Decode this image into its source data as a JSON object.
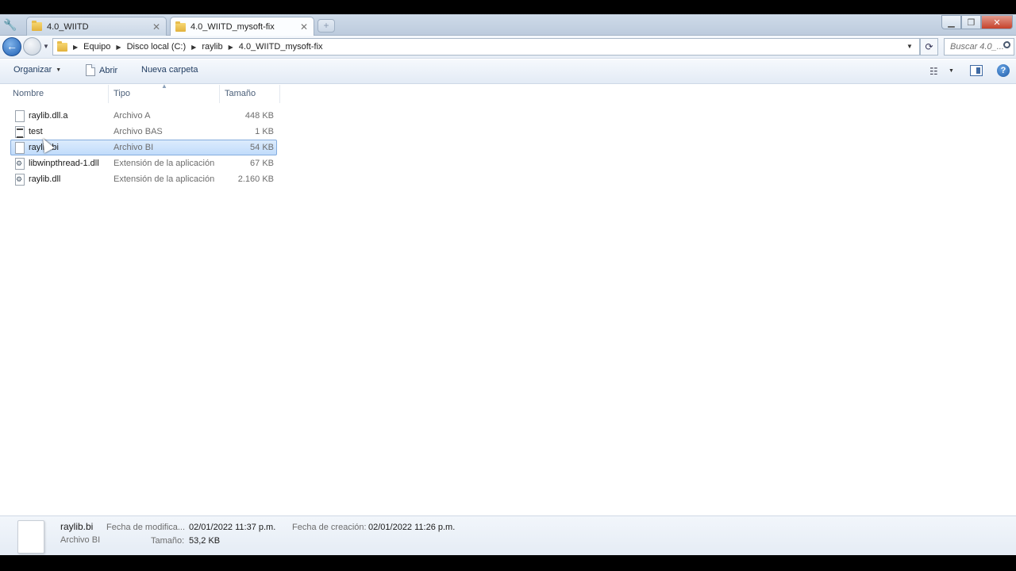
{
  "tabs": [
    {
      "label": "4.0_WIITD",
      "active": false
    },
    {
      "label": "4.0_WIITD_mysoft-fix",
      "active": true
    }
  ],
  "address": {
    "crumbs": [
      "Equipo",
      "Disco local (C:)",
      "raylib",
      "4.0_WIITD_mysoft-fix"
    ],
    "search_placeholder": "Buscar 4.0_..."
  },
  "toolbar": {
    "organize_label": "Organizar",
    "open_label": "Abrir",
    "new_folder_label": "Nueva carpeta"
  },
  "columns": {
    "name": "Nombre",
    "type": "Tipo",
    "size": "Tamaño"
  },
  "files": [
    {
      "name": "raylib.dll.a",
      "type": "Archivo A",
      "size": "448 KB",
      "icon": "file-icon",
      "selected": false
    },
    {
      "name": "test",
      "type": "Archivo BAS",
      "size": "1 KB",
      "icon": "bas-file-icon",
      "selected": false
    },
    {
      "name": "raylib.bi",
      "type": "Archivo BI",
      "size": "54 KB",
      "icon": "file-icon",
      "selected": true
    },
    {
      "name": "libwinpthread-1.dll",
      "type": "Extensión de la aplicación",
      "size": "67 KB",
      "icon": "dll-file-icon",
      "selected": false
    },
    {
      "name": "raylib.dll",
      "type": "Extensión de la aplicación",
      "size": "2.160 KB",
      "icon": "dll-file-icon",
      "selected": false
    }
  ],
  "details": {
    "name": "raylib.bi",
    "type": "Archivo BI",
    "modified_label": "Fecha de modifica...",
    "modified_value": "02/01/2022 11:37 p.m.",
    "size_label": "Tamaño:",
    "size_value": "53,2 KB",
    "created_label": "Fecha de creación:",
    "created_value": "02/01/2022 11:26 p.m."
  },
  "colors": {
    "selection": "#cce4fc",
    "accent": "#1f5fb3"
  }
}
